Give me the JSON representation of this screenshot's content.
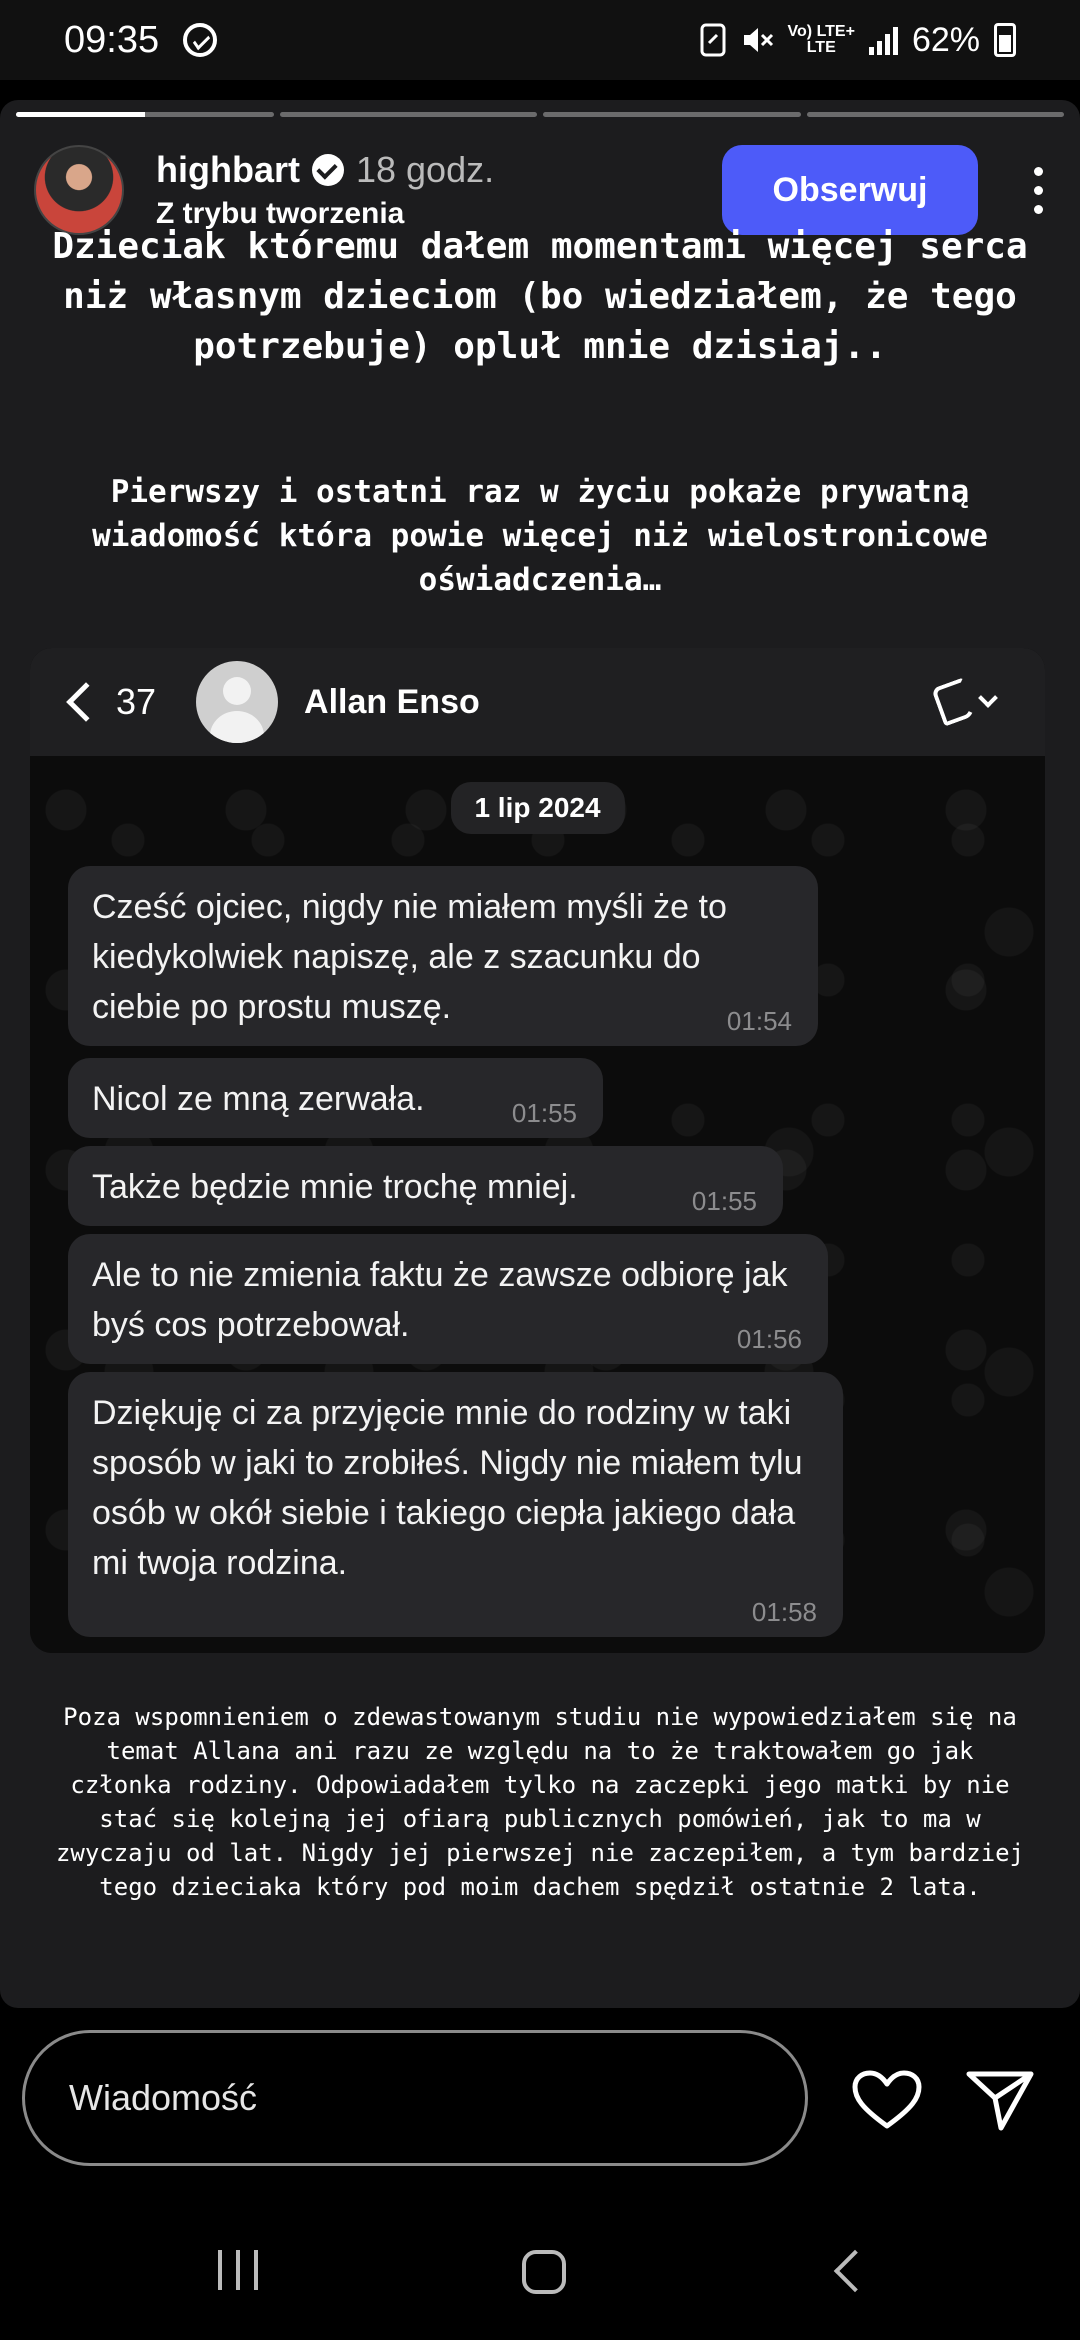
{
  "status_bar": {
    "time": "09:35",
    "network_top": "Vo) LTE+",
    "network_bottom": "LTE",
    "battery": "62%",
    "battery_level": 0.62
  },
  "story": {
    "progress": {
      "segments": 4,
      "active_index": 0,
      "active_fill": 0.5
    },
    "user": {
      "username": "highbart",
      "time_ago": "18 godz.",
      "subtitle": "Z trybu tworzenia",
      "verified": true
    },
    "follow_label": "Obserwuj",
    "headline": "Dzieciak któremu dałem momentami więcej serca niż własnym dzieciom (bo wiedziałem, że tego potrzebuje) opluł mnie dzisiaj..",
    "paragraph1": "Pierwszy i ostatni raz w życiu pokaże prywatną wiadomość która powie więcej niż wielostronicowe oświadczenia…",
    "paragraph2": "Poza wspomnieniem o zdewastowanym studiu nie wypowiedziałem się na temat Allana ani razu ze względu na to że traktowałem go jak członka rodziny. Odpowiadałem tylko na zaczepki jego matki by nie stać się  kolejną jej ofiarą publicznych pomówień, jak to ma w zwyczaju od lat. Nigdy jej pierwszej nie zaczepiłem, a tym bardziej tego dzieciaka który pod moim dachem spędził ostatnie 2 lata."
  },
  "chat": {
    "back_count": "37",
    "contact_name": "Allan Enso",
    "date": "1 lip 2024",
    "messages": [
      {
        "text": "Cześć ojciec, nigdy nie miałem myśli że to kiedykolwiek napiszę, ale z szacunku do ciebie po prostu muszę.",
        "time": "01:54"
      },
      {
        "text": "Nicol ze mną zerwała.",
        "time": "01:55"
      },
      {
        "text": "Także będzie mnie trochę mniej.",
        "time": "01:55"
      },
      {
        "text": "Ale to nie zmienia faktu że zawsze odbiorę jak byś cos potrzebował.",
        "time": "01:56"
      },
      {
        "text": "Dziękuję ci za przyjęcie mnie do rodziny w taki sposób w jaki to zrobiłeś. Nigdy nie miałem tylu osób w okół siebie i takiego ciepła jakiego dała mi twoja rodzina.",
        "time": "01:58"
      }
    ]
  },
  "composer": {
    "placeholder": "Wiadomość"
  },
  "colors": {
    "follow_button": "#4d5bf9",
    "story_bg": "#1c1c1e",
    "bubble_bg": "#27272a"
  },
  "icons": [
    "messenger-icon",
    "verified-icon",
    "more-icon",
    "back-icon",
    "phone-icon",
    "heart-icon",
    "send-icon"
  ]
}
